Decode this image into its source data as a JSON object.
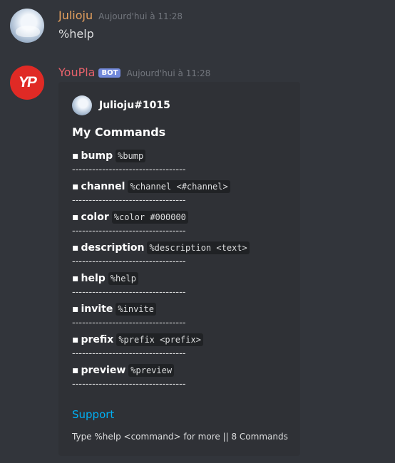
{
  "messages": [
    {
      "author": "Julioju",
      "timestamp": "Aujourd'hui à 11:28",
      "content": "%help",
      "author_color": "#e8a25f"
    },
    {
      "author": "YouPla",
      "bot_tag": "BOT",
      "timestamp": "Aujourd'hui à 11:28",
      "avatar_text": "YP",
      "author_color": "#e8626b",
      "embed": {
        "author_name": "Julioju#1015",
        "title": "My Commands",
        "bullet": "▪",
        "separator": "----------------------------------",
        "commands": [
          {
            "name": "bump",
            "usage": "%bump"
          },
          {
            "name": "channel",
            "usage": "%channel <#channel>"
          },
          {
            "name": "color",
            "usage": "%color #000000"
          },
          {
            "name": "description",
            "usage": "%description <text>"
          },
          {
            "name": "help",
            "usage": "%help"
          },
          {
            "name": "invite",
            "usage": "%invite"
          },
          {
            "name": "prefix",
            "usage": "%prefix <prefix>"
          },
          {
            "name": "preview",
            "usage": "%preview"
          }
        ],
        "link_label": "Support",
        "footer": "Type %help <command> for more || 8 Commands"
      }
    }
  ],
  "colors": {
    "background": "#36393f",
    "embed_background": "#2f3136",
    "link": "#00b0f4",
    "bot_tag": "#7289da",
    "bot_avatar": "#e02a25"
  },
  "icons": {
    "user_avatar": "user-avatar-icon",
    "bot_avatar": "youpla-logo-icon"
  }
}
